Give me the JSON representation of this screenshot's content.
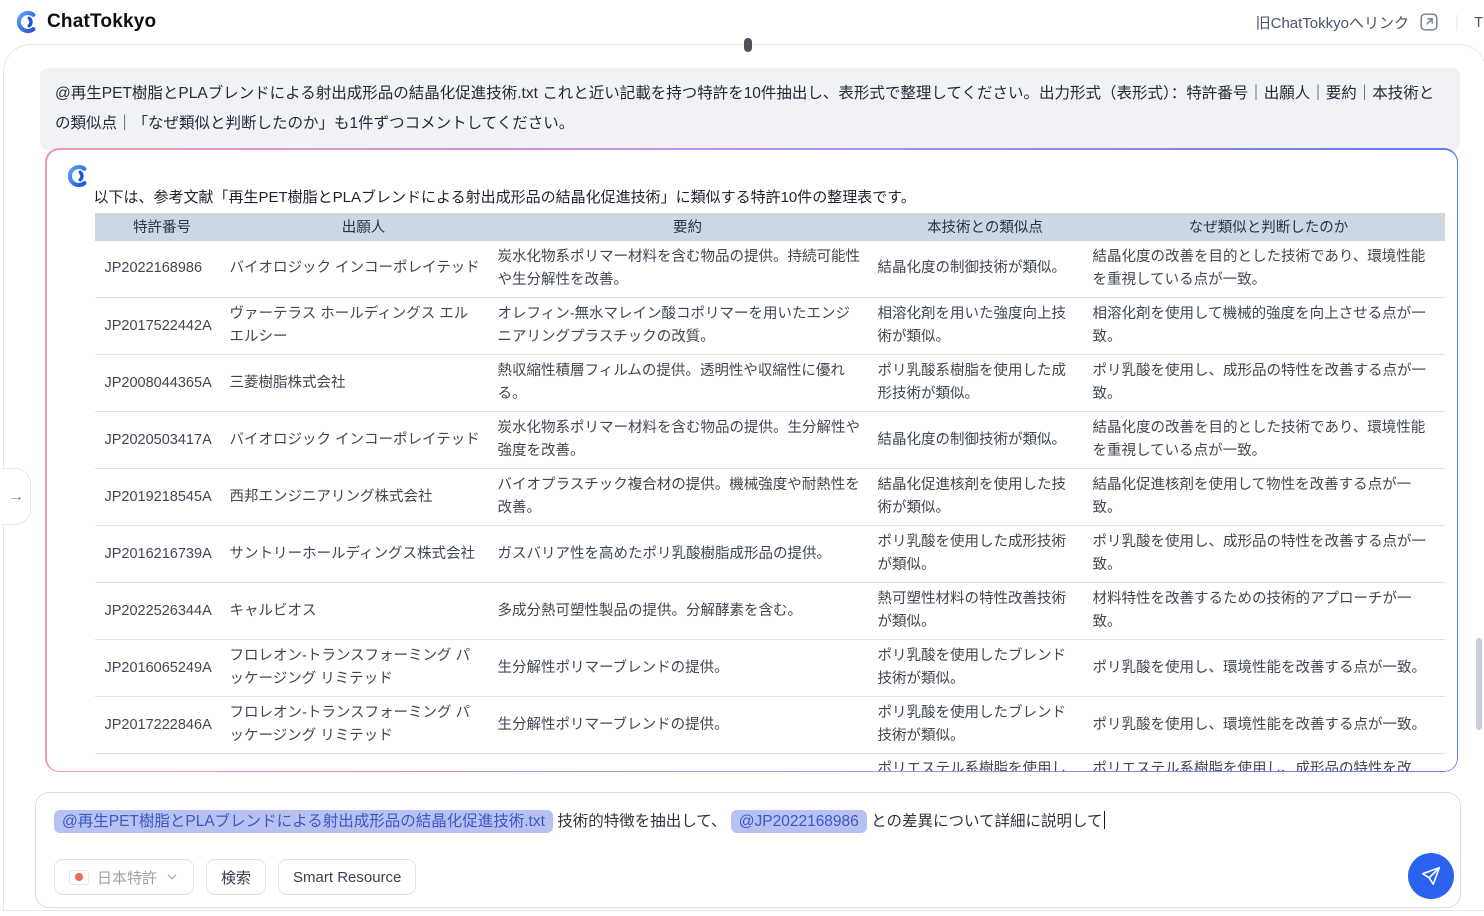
{
  "header": {
    "app_title": "ChatTokkyo",
    "old_link_label": "旧ChatTokkyoへリンク",
    "right_truncated": "T"
  },
  "user_message": "@再生PET樹脂とPLAブレンドによる射出成形品の結晶化促進技術.txt これと近い記載を持つ特許を10件抽出し、表形式で整理してください。出力形式（表形式）：特許番号｜出願人｜要約｜本技術との類似点｜「なぜ類似と判断したのか」も1件ずつコメントしてください。",
  "assistant": {
    "intro": "以下は、参考文献「再生PET樹脂とPLAブレンドによる射出成形品の結晶化促進技術」に類似する特許10件の整理表です。",
    "table": {
      "headers": [
        "特許番号",
        "出願人",
        "要約",
        "本技術との類似点",
        "なぜ類似と判断したのか"
      ],
      "rows": [
        {
          "patent": "JP2022168986",
          "applicant": "バイオロジック インコーポレイテッド",
          "summary": "炭水化物系ポリマー材料を含む物品の提供。持続可能性や生分解性を改善。",
          "similarity": "結晶化度の制御技術が類似。",
          "reason": "結晶化度の改善を目的とした技術であり、環境性能を重視している点が一致。"
        },
        {
          "patent": "JP2017522442A",
          "applicant": "ヴァーテラス ホールディングス エル エルシー",
          "summary": "オレフィン-無水マレイン酸コポリマーを用いたエンジニアリングプラスチックの改質。",
          "similarity": "相溶化剤を用いた強度向上技術が類似。",
          "reason": "相溶化剤を使用して機械的強度を向上させる点が一致。"
        },
        {
          "patent": "JP2008044365A",
          "applicant": "三菱樹脂株式会社",
          "summary": "熱収縮性積層フィルムの提供。透明性や収縮性に優れる。",
          "similarity": "ポリ乳酸系樹脂を使用した成形技術が類似。",
          "reason": "ポリ乳酸を使用し、成形品の特性を改善する点が一致。"
        },
        {
          "patent": "JP2020503417A",
          "applicant": "バイオロジック インコーポレイテッド",
          "summary": "炭水化物系ポリマー材料を含む物品の提供。生分解性や強度を改善。",
          "similarity": "結晶化度の制御技術が類似。",
          "reason": "結晶化度の改善を目的とした技術であり、環境性能を重視している点が一致。"
        },
        {
          "patent": "JP2019218545A",
          "applicant": "西邦エンジニアリング株式会社",
          "summary": "バイオプラスチック複合材の提供。機械強度や耐熱性を改善。",
          "similarity": "結晶化促進核剤を使用した技術が類似。",
          "reason": "結晶化促進核剤を使用して物性を改善する点が一致。"
        },
        {
          "patent": "JP2016216739A",
          "applicant": "サントリーホールディングス株式会社",
          "summary": "ガスバリア性を高めたポリ乳酸樹脂成形品の提供。",
          "similarity": "ポリ乳酸を使用した成形技術が類似。",
          "reason": "ポリ乳酸を使用し、成形品の特性を改善する点が一致。"
        },
        {
          "patent": "JP2022526344A",
          "applicant": "キャルビオス",
          "summary": "多成分熱可塑性製品の提供。分解酵素を含む。",
          "similarity": "熱可塑性材料の特性改善技術が類似。",
          "reason": "材料特性を改善するための技術的アプローチが一致。"
        },
        {
          "patent": "JP2016065249A",
          "applicant": "フロレオン-トランスフォーミング パッケージング リミテッド",
          "summary": "生分解性ポリマーブレンドの提供。",
          "similarity": "ポリ乳酸を使用したブレンド技術が類似。",
          "reason": "ポリ乳酸を使用し、環境性能を改善する点が一致。"
        },
        {
          "patent": "JP2017222846A",
          "applicant": "フロレオン-トランスフォーミング パッケージング リミテッド",
          "summary": "生分解性ポリマーブレンドの提供。",
          "similarity": "ポリ乳酸を使用したブレンド技術が類似。",
          "reason": "ポリ乳酸を使用し、環境性能を改善する点が一致。"
        }
      ],
      "partial_row": {
        "patent": "",
        "applicant": "",
        "summary": "",
        "similarity": "ポリエステル系樹脂を使用し",
        "reason": "ポリエステル系樹脂を使用し、成形品の特性を改"
      }
    }
  },
  "composer": {
    "chip1": "@再生PET樹脂とPLAブレンドによる射出成形品の結晶化促進技術.txt",
    "text1": " 技術的特徴を抽出して、 ",
    "chip2": "@JP2022168986",
    "text2": " との差異について詳細に説明して",
    "db_selector_label": "日本特許",
    "search_button": "検索",
    "smart_resource_button": "Smart Resource"
  },
  "icons": {
    "logo": "chattokkyo-swirl-icon",
    "external_link": "external-link-icon",
    "flag": "japan-flag-icon",
    "chevron": "chevron-down-icon",
    "send": "paper-plane-icon",
    "sidebar_toggle": "arrow-right-icon"
  },
  "colors": {
    "brand_blue": "#2b63f0",
    "chip_bg": "#b7c2f1",
    "chip_text": "#3f56c7",
    "table_header_bg": "#cdd6e3",
    "card_border_gradient": [
      "#ef9ab5",
      "#b78df2",
      "#5f7cf0"
    ],
    "user_bubble_bg": "#f0f2f5",
    "flag_red": "#ed6a5e"
  }
}
